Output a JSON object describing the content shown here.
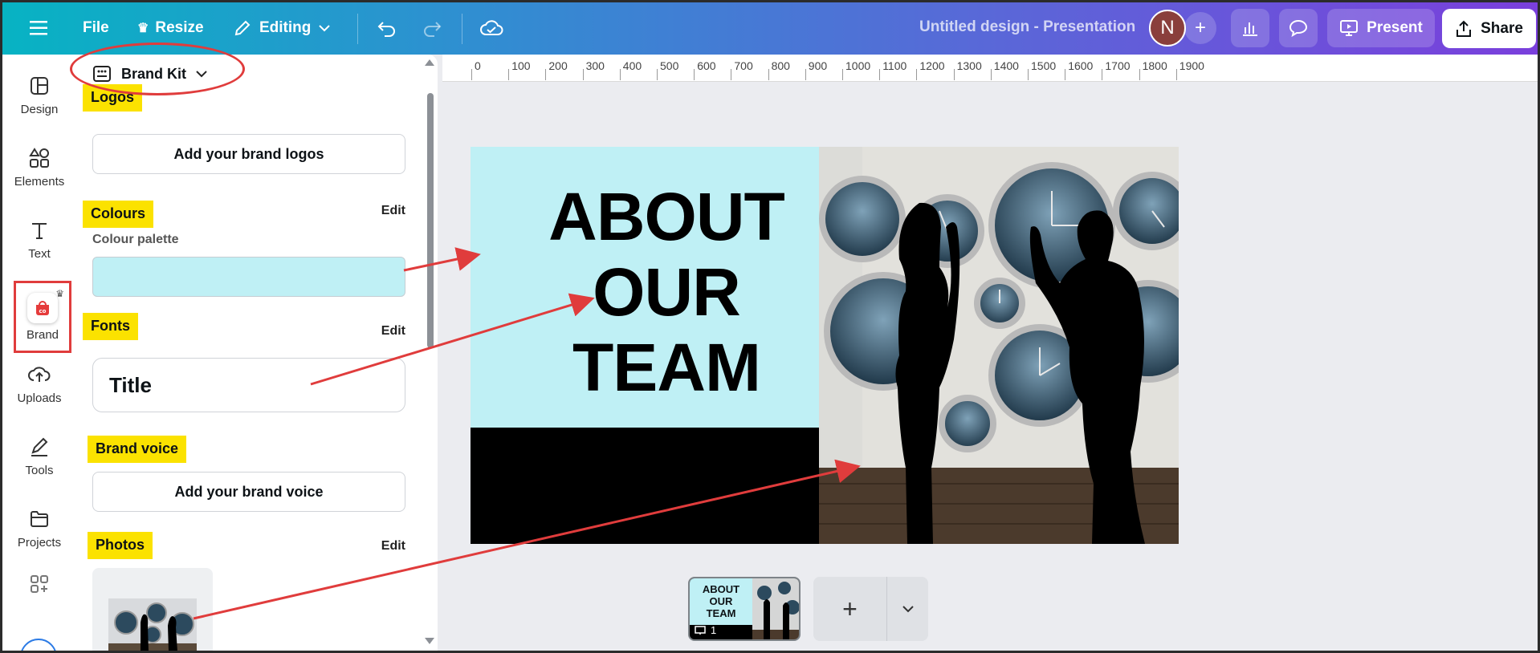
{
  "topbar": {
    "file_label": "File",
    "resize_label": "Resize",
    "editing_label": "Editing",
    "doc_title": "Untitled design - Presentation",
    "avatar_initial": "N",
    "present_label": "Present",
    "share_label": "Share"
  },
  "rail": {
    "items": [
      {
        "label": "Design",
        "icon": "design-icon"
      },
      {
        "label": "Elements",
        "icon": "elements-icon"
      },
      {
        "label": "Text",
        "icon": "text-icon"
      },
      {
        "label": "Brand",
        "icon": "brand-icon"
      },
      {
        "label": "Uploads",
        "icon": "uploads-icon"
      },
      {
        "label": "Tools",
        "icon": "tools-icon"
      },
      {
        "label": "Projects",
        "icon": "projects-icon"
      }
    ]
  },
  "panel": {
    "brandkit_label": "Brand Kit",
    "logos_label": "Logos",
    "add_logos_label": "Add your brand logos",
    "colours_label": "Colours",
    "colours_edit": "Edit",
    "palette_label": "Colour palette",
    "swatch_color": "#bff0f5",
    "fonts_label": "Fonts",
    "fonts_edit": "Edit",
    "font_title_label": "Title",
    "voice_label": "Brand voice",
    "add_voice_label": "Add your brand voice",
    "photos_label": "Photos",
    "photos_edit": "Edit"
  },
  "ruler": {
    "ticks": [
      "0",
      "100",
      "200",
      "300",
      "400",
      "500",
      "600",
      "700",
      "800",
      "900",
      "1000",
      "1100",
      "1200",
      "1300",
      "1400",
      "1500",
      "1600",
      "1700",
      "1800",
      "1900"
    ]
  },
  "slide": {
    "title_line1": "ABOUT",
    "title_line2": "OUR",
    "title_line3": "TEAM",
    "background_color": "#bff0f5"
  },
  "pages": {
    "thumb_title1": "ABOUT",
    "thumb_title2": "OUR",
    "thumb_title3": "TEAM",
    "page_number": "1"
  },
  "colors": {
    "annotation_red": "#e03c3c",
    "highlight_yellow": "#fbe200"
  }
}
